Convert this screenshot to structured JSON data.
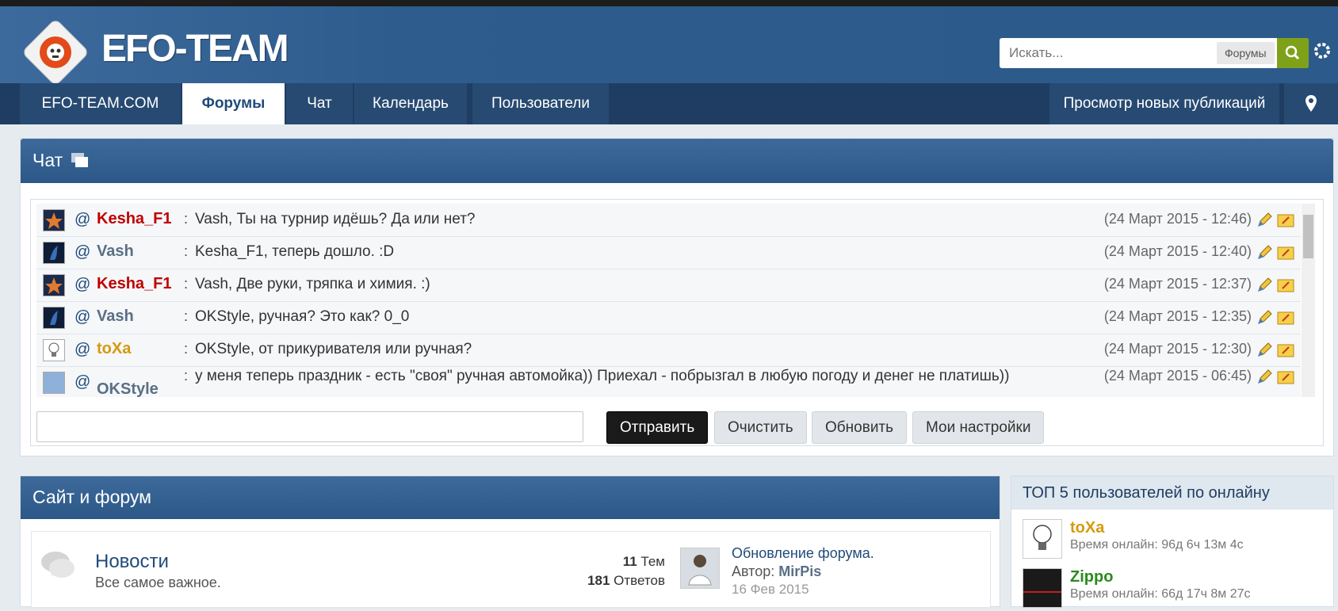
{
  "header": {
    "logo_text": "EFO-TEAM",
    "search_placeholder": "Искать...",
    "search_scope": "Форумы"
  },
  "nav": {
    "items": [
      {
        "label": "EFO-TEAM.COM"
      },
      {
        "label": "Форумы"
      },
      {
        "label": "Чат"
      },
      {
        "label": "Календарь"
      },
      {
        "label": "Пользователи"
      }
    ],
    "right_label": "Просмотр новых публикаций"
  },
  "chat": {
    "title": "Чат",
    "messages": [
      {
        "user": "Kesha_F1",
        "color": "#c00000",
        "text": "Vash, Ты на турнир идёшь? Да или нет?",
        "time": "(24 Март 2015 - 12:46)"
      },
      {
        "user": "Vash",
        "color": "#5a6f85",
        "text": "Kesha_F1, теперь дошло. :D",
        "time": "(24 Март 2015 - 12:40)"
      },
      {
        "user": "Kesha_F1",
        "color": "#c00000",
        "text": "Vash, Две руки, тряпка и химия. :)",
        "time": "(24 Март 2015 - 12:37)"
      },
      {
        "user": "Vash",
        "color": "#5a6f85",
        "text": "OKStyle, ручная? Это как? 0_0",
        "time": "(24 Март 2015 - 12:35)"
      },
      {
        "user": "toXa",
        "color": "#d49a10",
        "text": "OKStyle, от прикуривателя или ручная?",
        "time": "(24 Март 2015 - 12:30)"
      },
      {
        "user": "OKStyle",
        "color": "#5a6f85",
        "text": "у меня теперь праздник - есть \"своя\" ручная автомойка)) Приехал - побрызгал в любую погоду и денег не платишь))",
        "time": "(24 Март 2015 - 06:45)"
      }
    ],
    "buttons": {
      "send": "Отправить",
      "clear": "Очистить",
      "refresh": "Обновить",
      "settings": "Мои настройки"
    }
  },
  "forum": {
    "title": "Сайт и форум",
    "row": {
      "name": "Новости",
      "desc": "Все самое важное.",
      "topics_count": "11",
      "topics_label": "Тем",
      "replies_count": "181",
      "replies_label": "Ответов",
      "last_title": "Обновление форума.",
      "last_author_label": "Автор:",
      "last_author": "MirPis",
      "last_date": "16 Фев 2015"
    }
  },
  "top_users": {
    "title": "ТОП 5 пользователей по онлайну",
    "users": [
      {
        "name": "toXa",
        "color": "#d49a10",
        "time": "Время онлайн: 96д 6ч 13м 4с"
      },
      {
        "name": "Zippo",
        "color": "#2a8a1e",
        "time": "Время онлайн: 66д 17ч 8м 27с"
      }
    ]
  }
}
